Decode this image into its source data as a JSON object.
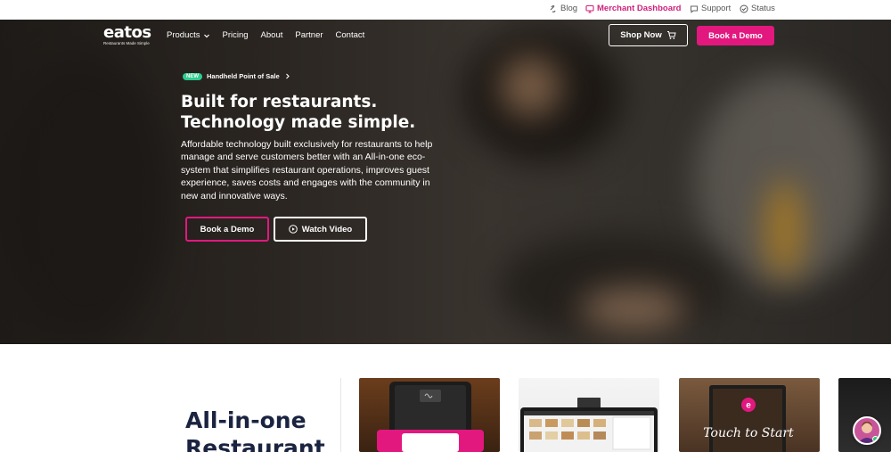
{
  "utility": {
    "blog": "Blog",
    "merchant_dashboard": "Merchant Dashboard",
    "support": "Support",
    "status": "Status"
  },
  "brand": {
    "logo_text": "eatos",
    "tagline": "Restaurants Made Simple",
    "accent": "#e2187f",
    "badge_color": "#2ecc8f"
  },
  "nav": {
    "items": [
      {
        "label": "Products",
        "has_dropdown": true
      },
      {
        "label": "Pricing"
      },
      {
        "label": "About"
      },
      {
        "label": "Partner"
      },
      {
        "label": "Contact"
      }
    ],
    "shop_now": "Shop Now",
    "book_demo": "Book a Demo"
  },
  "hero": {
    "badge": "NEW",
    "badge_text": "Handheld Point of Sale",
    "headline_line1": "Built for restaurants.",
    "headline_line2": "Technology made simple.",
    "description": "Affordable technology built exclusively for restaurants to help manage and serve customers better with an All-in-one eco-system that simplifies restaurant operations, improves guest experience, saves costs and engages with the community in new and innovative ways.",
    "book_demo": "Book a Demo",
    "watch_video": "Watch Video"
  },
  "section": {
    "title_line1": "All-in-one",
    "title_line2": "Restaurant"
  },
  "cards": [
    {
      "name": "handheld-pos-device"
    },
    {
      "name": "pos-terminal"
    },
    {
      "name": "touch-to-start-kiosk",
      "text": "Touch to Start"
    },
    {
      "name": "product-card-4"
    }
  ]
}
